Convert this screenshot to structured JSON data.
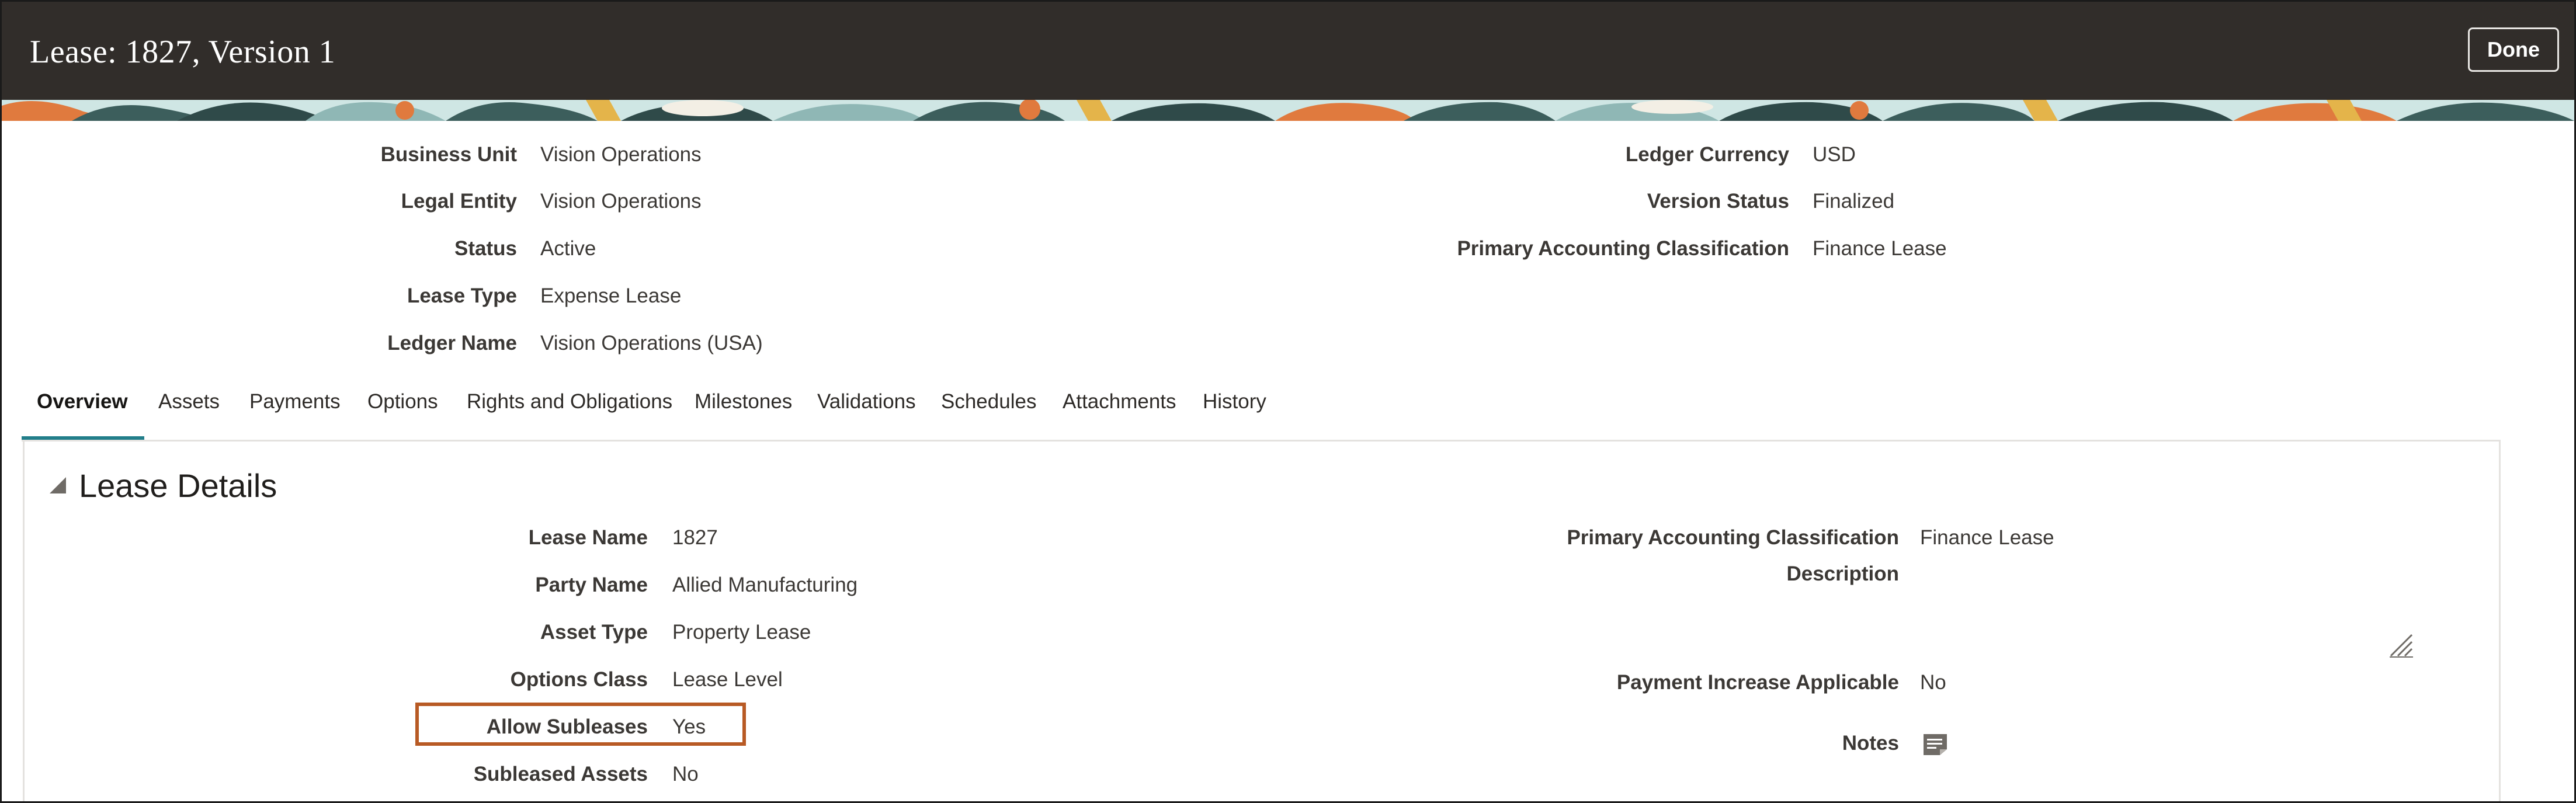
{
  "header": {
    "title": "Lease: 1827, Version 1",
    "done_label": "Done"
  },
  "summary": {
    "left": [
      {
        "label": "Business Unit",
        "value": "Vision Operations"
      },
      {
        "label": "Legal Entity",
        "value": "Vision Operations"
      },
      {
        "label": "Status",
        "value": "Active"
      },
      {
        "label": "Lease Type",
        "value": "Expense Lease"
      },
      {
        "label": "Ledger Name",
        "value": "Vision Operations (USA)"
      }
    ],
    "right": [
      {
        "label": "Ledger Currency",
        "value": "USD"
      },
      {
        "label": "Version Status",
        "value": "Finalized"
      },
      {
        "label": "Primary Accounting Classification",
        "value": "Finance Lease"
      }
    ]
  },
  "tabs": [
    "Overview",
    "Assets",
    "Payments",
    "Options",
    "Rights and Obligations",
    "Milestones",
    "Validations",
    "Schedules",
    "Attachments",
    "History"
  ],
  "active_tab": "Overview",
  "details": {
    "section_title": "Lease Details",
    "left": [
      {
        "label": "Lease Name",
        "value": "1827"
      },
      {
        "label": "Party Name",
        "value": "Allied Manufacturing"
      },
      {
        "label": "Asset Type",
        "value": "Property Lease"
      },
      {
        "label": "Options Class",
        "value": "Lease Level"
      },
      {
        "label": "Allow Subleases",
        "value": "Yes"
      },
      {
        "label": "Subleased Assets",
        "value": "No"
      }
    ],
    "right": {
      "primary_classification_label": "Primary Accounting Classification",
      "primary_classification_value": "Finance Lease",
      "description_label": "Description",
      "description_value": "",
      "payment_increase_label": "Payment Increase Applicable",
      "payment_increase_value": "No",
      "notes_label": "Notes"
    }
  },
  "colors": {
    "header_bg": "#312d2a",
    "tab_accent": "#227e8a",
    "highlight_border": "#b85a24"
  },
  "icons": {
    "collapse": "triangle-expanded-icon",
    "resize": "resize-handle-icon",
    "notes": "note-icon"
  }
}
